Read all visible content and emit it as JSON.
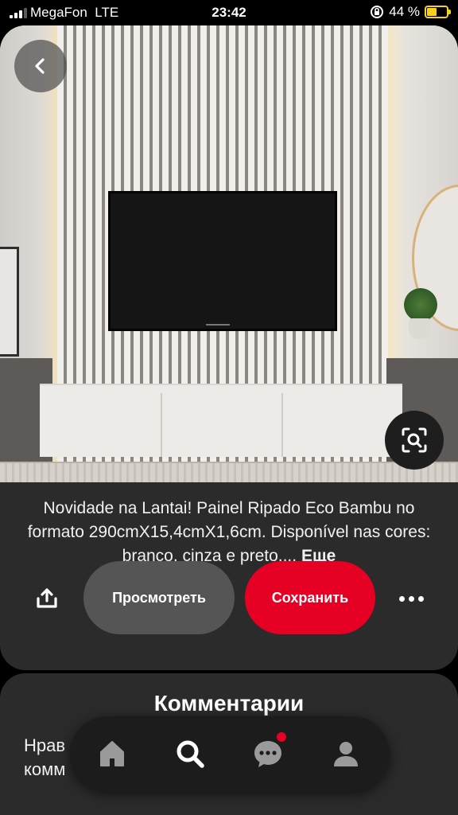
{
  "status_bar": {
    "carrier": "MegaFon",
    "network": "LTE",
    "time": "23:42",
    "battery_percent": "44 %",
    "accent_color": "#f7d11a"
  },
  "pin": {
    "back_icon": "chevron-left-icon",
    "visual_search_icon": "lens-search-icon",
    "description": "Novidade na Lantai! Painel Ripado Eco Bambu no formato 290cmX15,4cmX1,6cm. Disponível nas cores: branco, cinza e preto....",
    "more_link": "Еще"
  },
  "actions": {
    "share_icon": "share-icon",
    "view_label": "Просмотреть",
    "save_label": "Сохранить",
    "more_icon": "more-dots-icon",
    "save_color": "#e60023"
  },
  "comments": {
    "title": "Комментарии",
    "text": "Нрав\nкомм",
    "footer_text": "…"
  },
  "nav": {
    "items": [
      {
        "icon": "home-icon"
      },
      {
        "icon": "search-icon"
      },
      {
        "icon": "messages-icon",
        "has_notification": true
      },
      {
        "icon": "profile-icon"
      }
    ]
  }
}
